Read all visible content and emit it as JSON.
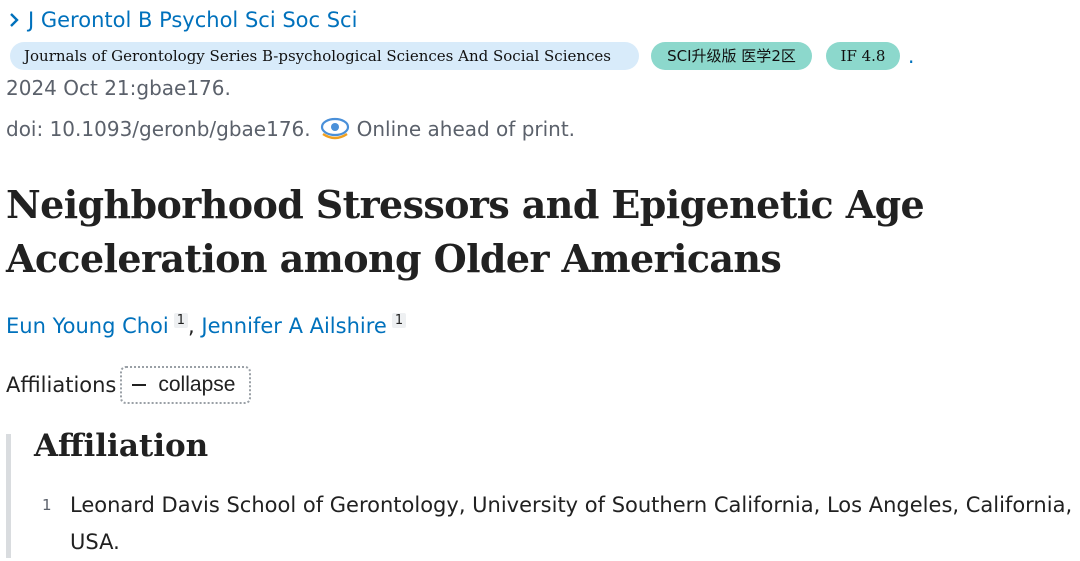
{
  "journal": {
    "link_text": "J Gerontol B Psychol Sci Soc Sci"
  },
  "badges": {
    "journal_full": "Journals of Gerontology Series B-psychological Sciences And Social Sciences",
    "sci": "SCI升级版 医学2区",
    "impact_factor": "IF 4.8",
    "trailing": "."
  },
  "pub": {
    "date": "2024 Oct 21:gbae176.",
    "doi": "doi: 10.1093/geronb/gbae176.",
    "status": "Online ahead of print."
  },
  "article": {
    "title": "Neighborhood Stressors and Epigenetic Age Acceleration among Older Americans"
  },
  "authors": [
    {
      "name": "Eun Young Choi",
      "affil": "1"
    },
    {
      "name": "Jennifer A Ailshire",
      "affil": "1"
    }
  ],
  "affiliations_toggle": {
    "label": "Affiliations",
    "button": "collapse"
  },
  "affiliation_section": {
    "heading": "Affiliation",
    "items": [
      {
        "num": "1",
        "text": "Leonard Davis School of Gerontology, University of Southern California, Los Angeles, California, USA."
      }
    ]
  },
  "colors": {
    "link": "#0071bc",
    "badge_journal": "#d8ebfa",
    "badge_teal": "#8cd8cc",
    "rule": "#d9dcdf"
  },
  "icons": [
    "chevron-right-icon",
    "epub-eye-icon"
  ]
}
